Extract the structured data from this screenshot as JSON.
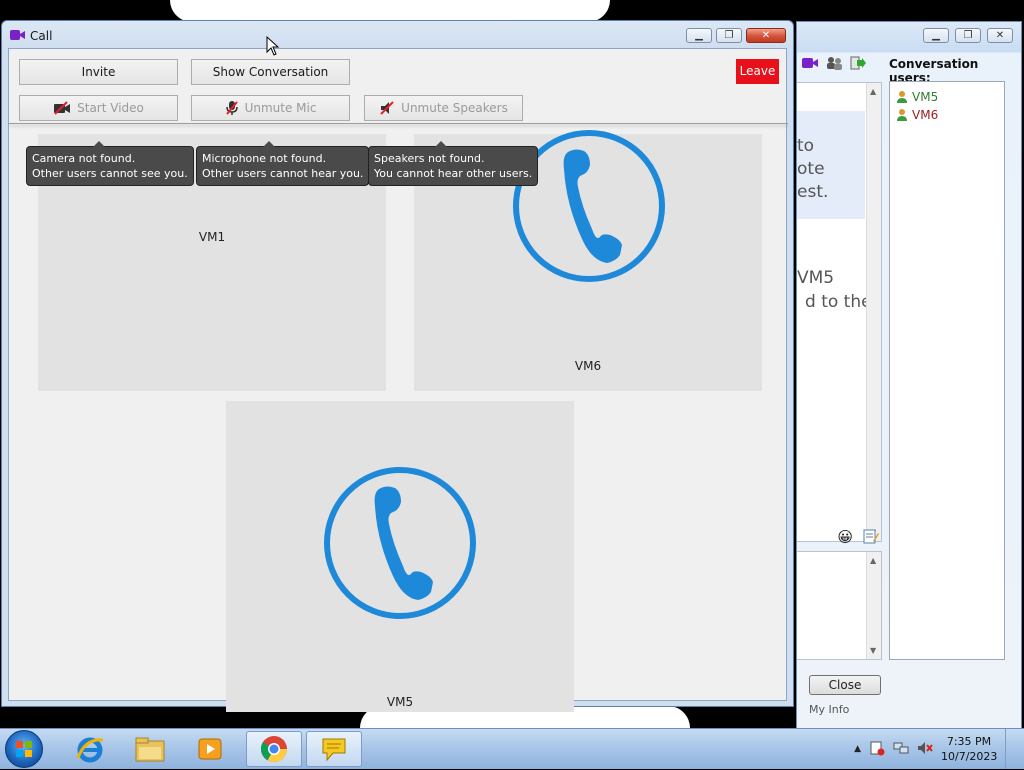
{
  "call_window": {
    "title": "Call",
    "buttons": {
      "invite": "Invite",
      "show_conversation": "Show Conversation",
      "leave": "Leave",
      "start_video": "Start Video",
      "unmute_mic": "Unmute Mic",
      "unmute_speakers": "Unmute Speakers"
    },
    "tooltips": {
      "camera_line1": "Camera not found.",
      "camera_line2": "Other users cannot see you.",
      "mic_line1": "Microphone not found.",
      "mic_line2": "Other users cannot hear you.",
      "speakers_line1": "Speakers not found.",
      "speakers_line2": "You cannot hear other users."
    },
    "participants": [
      "VM1",
      "VM6",
      "VM5"
    ]
  },
  "conversation_window": {
    "users_label": "Conversation users:",
    "users": [
      {
        "name": "VM5",
        "color": "#2f7d2f"
      },
      {
        "name": "VM6",
        "color": "#a02020"
      }
    ],
    "chat_fragments": [
      "to",
      "ote",
      "est.",
      "VM5",
      "d to the"
    ],
    "close_label": "Close",
    "my_info": "My Info"
  },
  "taskbar": {
    "time": "7:35 PM",
    "date": "10/7/2023"
  },
  "colors": {
    "accent_blue": "#1e88d9",
    "leave_red": "#e8101a",
    "tile_bg": "#e2e2e2"
  }
}
